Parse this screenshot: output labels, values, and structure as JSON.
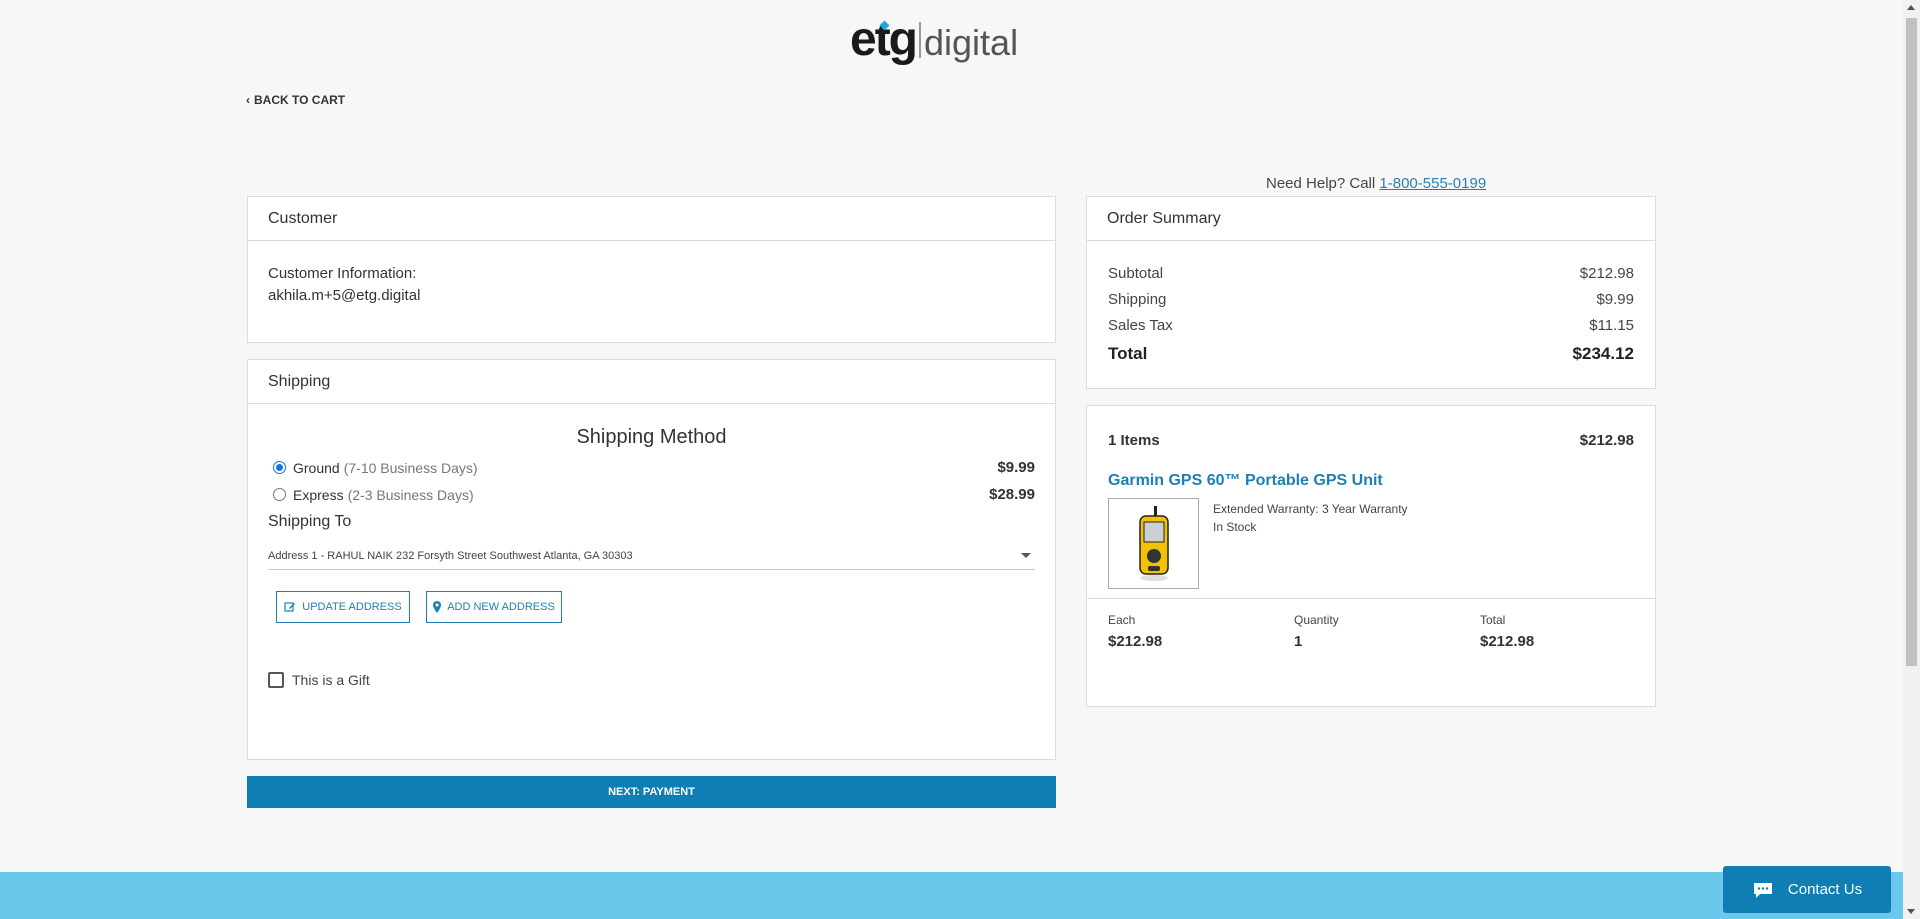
{
  "logo": {
    "primary": "etg",
    "secondary": "digital"
  },
  "nav": {
    "back_label": "BACK TO CART"
  },
  "help": {
    "prefix": "Need Help? Call",
    "phone": "1-800-555-0199"
  },
  "customer": {
    "header": "Customer",
    "info_label": "Customer Information:",
    "email": "akhila.m+5@etg.digital"
  },
  "shipping": {
    "header": "Shipping",
    "method_title": "Shipping Method",
    "options": [
      {
        "name": "Ground",
        "days": "(7-10 Business Days)",
        "price": "$9.99",
        "selected": true
      },
      {
        "name": "Express",
        "days": "(2-3 Business Days)",
        "price": "$28.99",
        "selected": false
      }
    ],
    "to_label": "Shipping To",
    "address": "Address 1 - RAHUL NAIK 232 Forsyth Street Southwest Atlanta, GA 30303",
    "update_label": "UPDATE ADDRESS",
    "add_label": "ADD NEW ADDRESS",
    "gift_label": "This is a Gift"
  },
  "next_button": "NEXT: PAYMENT",
  "summary": {
    "header": "Order Summary",
    "subtotal_label": "Subtotal",
    "subtotal": "$212.98",
    "shipping_label": "Shipping",
    "shipping": "$9.99",
    "tax_label": "Sales Tax",
    "tax": "$11.15",
    "total_label": "Total",
    "total": "$234.12"
  },
  "items": {
    "count_label": "1 Items",
    "amount": "$212.98",
    "product_name": "Garmin GPS 60™ Portable GPS Unit",
    "warranty": "Extended Warranty: 3 Year Warranty",
    "stock": "In Stock",
    "each_label": "Each",
    "each": "$212.98",
    "qty_label": "Quantity",
    "qty": "1",
    "total_label": "Total",
    "total": "$212.98"
  },
  "contact": {
    "label": "Contact Us"
  },
  "colors": {
    "accent": "#0e7eb5",
    "link": "#1e7fb3",
    "footer": "#6ac8ec"
  }
}
